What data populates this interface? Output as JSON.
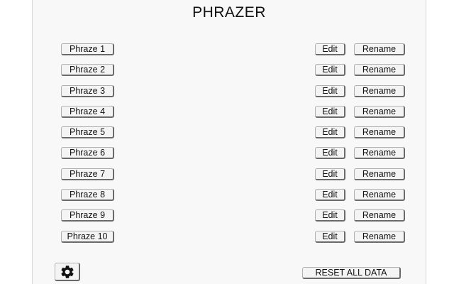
{
  "app": {
    "title": "PHRAZER"
  },
  "phrases": [
    {
      "label": "Phraze 1",
      "edit_label": "Edit",
      "rename_label": "Rename"
    },
    {
      "label": "Phraze 2",
      "edit_label": "Edit",
      "rename_label": "Rename"
    },
    {
      "label": "Phraze 3",
      "edit_label": "Edit",
      "rename_label": "Rename"
    },
    {
      "label": "Phraze 4",
      "edit_label": "Edit",
      "rename_label": "Rename"
    },
    {
      "label": "Phraze 5",
      "edit_label": "Edit",
      "rename_label": "Rename"
    },
    {
      "label": "Phraze 6",
      "edit_label": "Edit",
      "rename_label": "Rename"
    },
    {
      "label": "Phraze 7",
      "edit_label": "Edit",
      "rename_label": "Rename"
    },
    {
      "label": "Phraze 8",
      "edit_label": "Edit",
      "rename_label": "Rename"
    },
    {
      "label": "Phraze 9",
      "edit_label": "Edit",
      "rename_label": "Rename"
    },
    {
      "label": "Phraze 10",
      "edit_label": "Edit",
      "rename_label": "Rename"
    }
  ],
  "footer": {
    "settings_icon": "gear-icon",
    "reset_label": "RESET ALL DATA"
  }
}
